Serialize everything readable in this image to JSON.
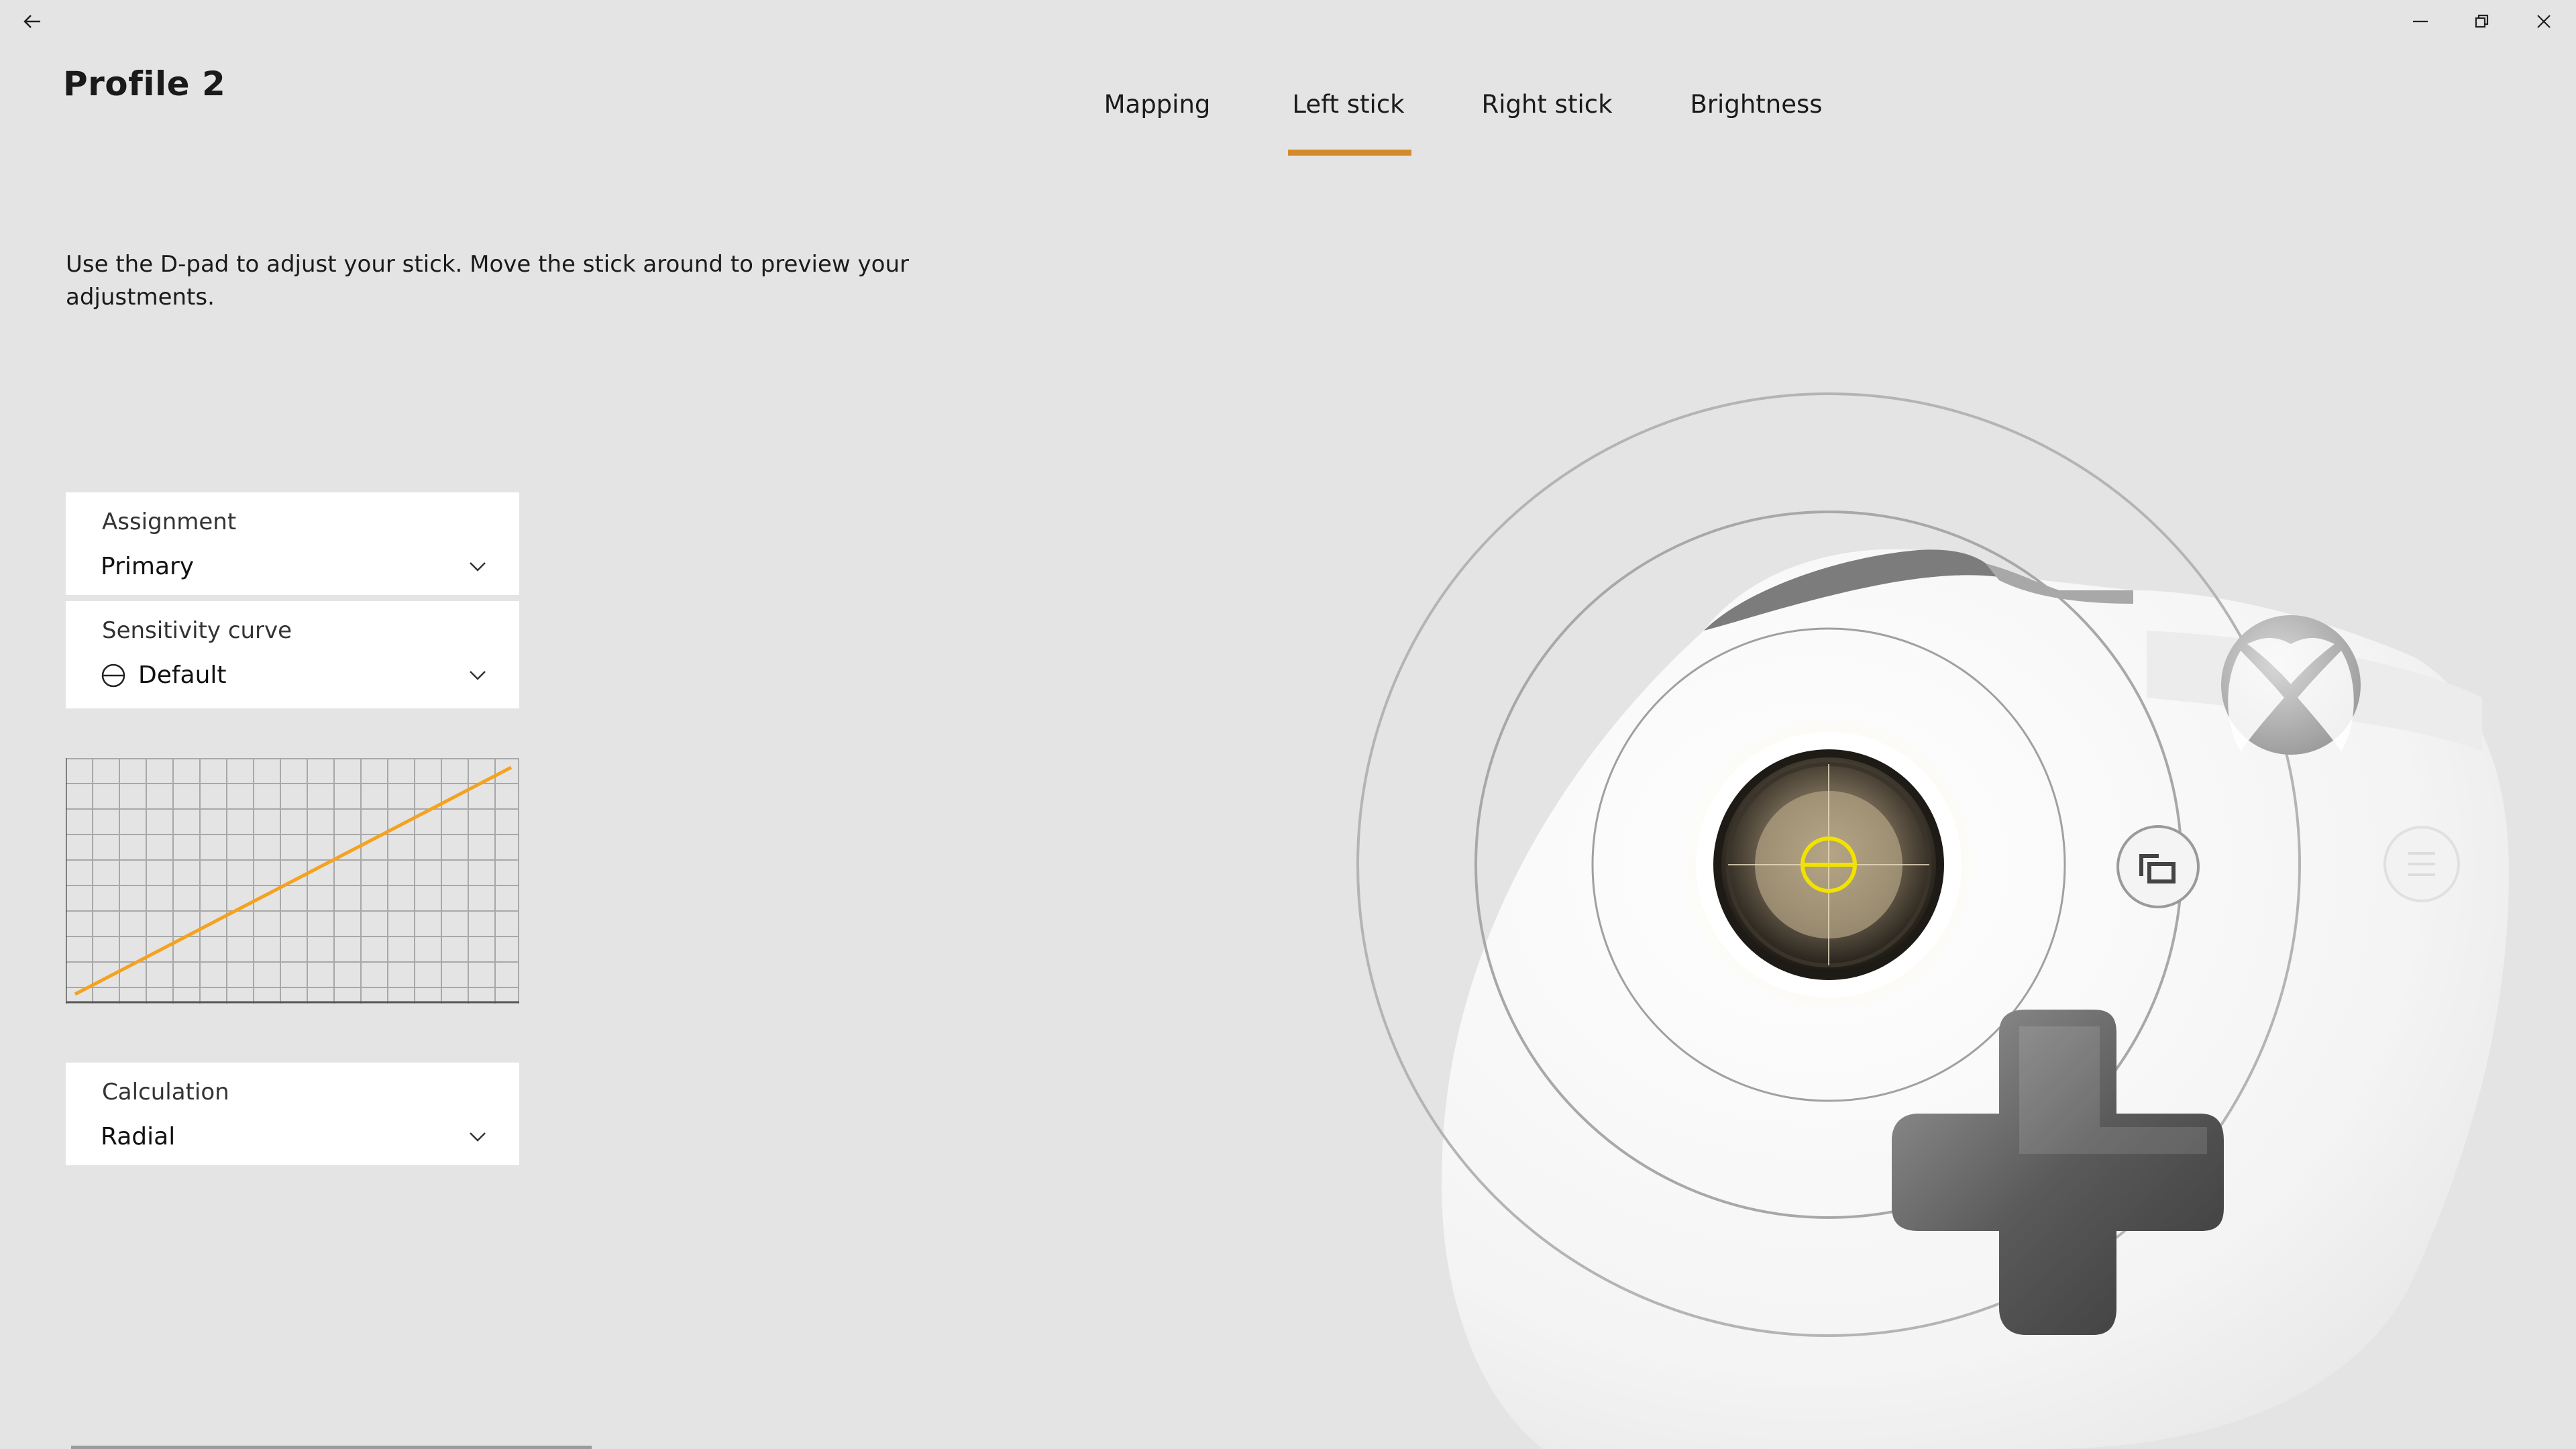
{
  "window": {
    "back_icon": "back-arrow-icon",
    "minimize_icon": "minimize-icon",
    "restore_icon": "restore-icon",
    "close_icon": "close-icon"
  },
  "profile": {
    "title": "Profile 2"
  },
  "tabs": [
    {
      "label": "Mapping",
      "selected": false
    },
    {
      "label": "Left stick",
      "selected": true
    },
    {
      "label": "Right stick",
      "selected": false
    },
    {
      "label": "Brightness",
      "selected": false
    }
  ],
  "instruction": "Use the D-pad to adjust your stick. Move the stick around to preview your adjustments.",
  "assignment": {
    "label": "Assignment",
    "value": "Primary"
  },
  "sensitivity": {
    "label": "Sensitivity curve",
    "value": "Default",
    "icon": "default-curve-icon"
  },
  "calculation": {
    "label": "Calculation",
    "value": "Radial"
  },
  "colors": {
    "accent": "#d48a2a",
    "curve": "#f4a21f",
    "background": "#e4e4e4",
    "stick_ring": "#f2e200"
  }
}
